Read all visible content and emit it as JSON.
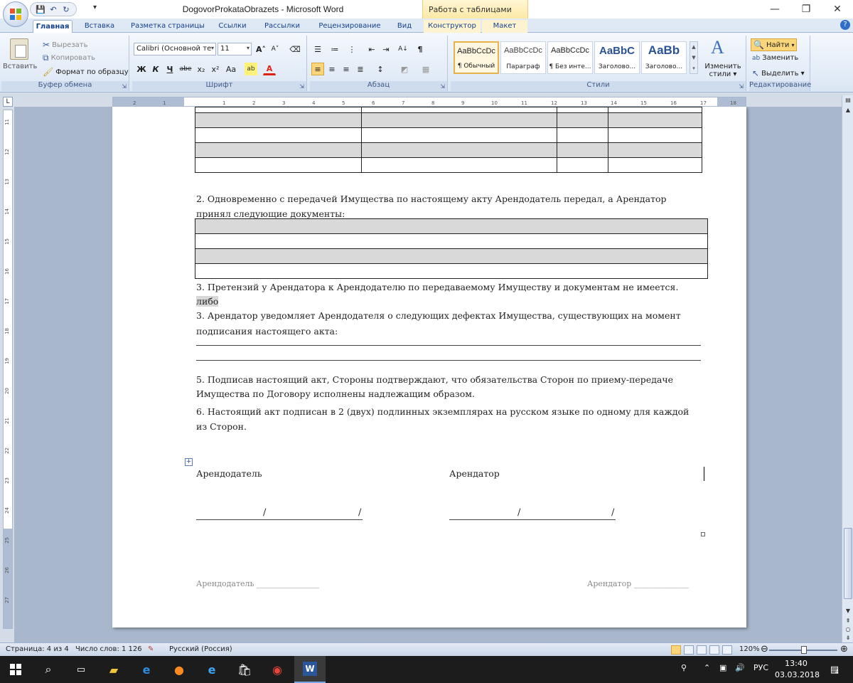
{
  "window": {
    "title": "DogovorProkataObrazets - Microsoft Word",
    "context_tab_title": "Работа с таблицами",
    "minimize": "—",
    "restore": "❐",
    "close": "✕"
  },
  "tabs": [
    {
      "label": "Главная",
      "active": true
    },
    {
      "label": "Вставка"
    },
    {
      "label": "Разметка страницы"
    },
    {
      "label": "Ссылки"
    },
    {
      "label": "Рассылки"
    },
    {
      "label": "Рецензирование"
    },
    {
      "label": "Вид"
    },
    {
      "label": "Конструктор",
      "context": true
    },
    {
      "label": "Макет",
      "context": true
    }
  ],
  "ribbon": {
    "clipboard": {
      "label": "Буфер обмена",
      "paste": "Вставить",
      "cut": "Вырезать",
      "copy": "Копировать",
      "format_painter": "Формат по образцу"
    },
    "font": {
      "label": "Шрифт",
      "font_name": "Calibri (Основной те",
      "font_size": "11",
      "bold": "Ж",
      "italic": "К",
      "underline": "Ч",
      "strike": "abe",
      "subscript": "x₂",
      "superscript": "x²",
      "change_case": "Aa",
      "grow": "A˄",
      "shrink": "A˅"
    },
    "paragraph": {
      "label": "Абзац"
    },
    "styles": {
      "label": "Стили",
      "items": [
        {
          "sample": "AaBbCcDc",
          "name": "¶ Обычный",
          "selected": true
        },
        {
          "sample": "AaBbCcDc",
          "name": "Параграф"
        },
        {
          "sample": "AaBbCcDc",
          "name": "¶ Без инте..."
        },
        {
          "sample": "AaBbC",
          "name": "Заголово..."
        },
        {
          "sample": "AaBb",
          "name": "Заголово..."
        }
      ],
      "change_styles_1": "Изменить",
      "change_styles_2": "стили ▾"
    },
    "editing": {
      "label": "Редактирование",
      "find": "Найти",
      "replace": "Заменить",
      "select": "Выделить ▾"
    }
  },
  "document": {
    "para2_line1": "2. Одновременно с передачей Имущества по настоящему акту Арендодатель передал, а Арендатор",
    "para2_line2": "принял следующие документы:",
    "para3a": "3. Претензий у Арендатора к Арендодателю по передаваемому Имуществу и документам не имеется.",
    "libo": "либо",
    "para3b_line1": "3. Арендатор уведомляет Арендодателя о следующих дефектах Имущества, существующих на момент",
    "para3b_line2": "подписания настоящего акта:",
    "para5_line1": " 5. Подписав настоящий акт, Стороны подтверждают, что обязательства Сторон по приему-передаче",
    "para5_line2": "Имущества по Договору исполнены надлежащим образом.",
    "para6_line1": "6. Настоящий акт подписан в 2 (двух) подлинных экземплярах на русском языке по одному для каждой",
    "para6_line2": "из Сторон.",
    "lessor": "Арендодатель",
    "lessee": "Арендатор",
    "slash": "/",
    "footer_lessor": "Арендодатель ________________",
    "footer_lessee": "Арендатор ______________"
  },
  "ruler": {
    "h_ticks": [
      "2",
      "1",
      "1",
      "2",
      "3",
      "4",
      "5",
      "6",
      "7",
      "8",
      "9",
      "10",
      "11",
      "12",
      "13",
      "14",
      "15",
      "16",
      "17",
      "18"
    ],
    "v_ticks": [
      "11",
      "12",
      "13",
      "14",
      "15",
      "16",
      "17",
      "18",
      "19",
      "20",
      "21",
      "22",
      "23",
      "24",
      "25",
      "26",
      "27"
    ]
  },
  "statusbar": {
    "page": "Страница: 4 из 4",
    "words": "Число слов: 1 126",
    "language": "Русский (Россия)",
    "zoom": "120%"
  },
  "taskbar": {
    "lang": "РУС",
    "time": "13:40",
    "date": "03.03.2018",
    "notifications": "4"
  }
}
